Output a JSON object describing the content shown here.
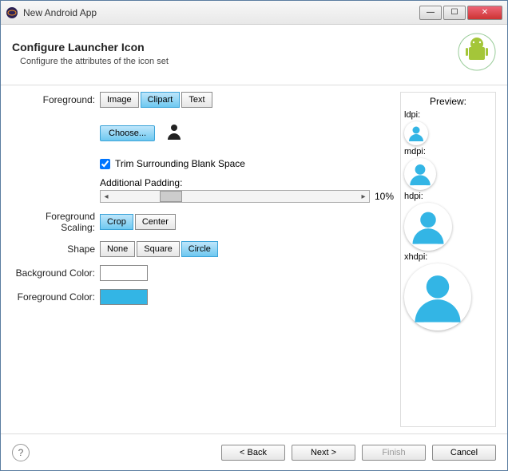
{
  "window": {
    "title": "New Android App"
  },
  "header": {
    "title": "Configure Launcher Icon",
    "subtitle": "Configure the attributes of the icon set"
  },
  "form": {
    "foreground_label": "Foreground:",
    "foreground_options": {
      "image": "Image",
      "clipart": "Clipart",
      "text": "Text"
    },
    "choose_label": "Choose...",
    "trim_label": "Trim Surrounding Blank Space",
    "trim_checked": true,
    "padding_label": "Additional Padding:",
    "padding_value": "10%",
    "scaling_label": "Foreground Scaling:",
    "scaling_options": {
      "crop": "Crop",
      "center": "Center"
    },
    "shape_label": "Shape",
    "shape_options": {
      "none": "None",
      "square": "Square",
      "circle": "Circle"
    },
    "bgcolor_label": "Background Color:",
    "bgcolor_value": "#ffffff",
    "fgcolor_label": "Foreground Color:",
    "fgcolor_value": "#33b5e5"
  },
  "preview": {
    "title": "Preview:",
    "ldpi": "ldpi:",
    "mdpi": "mdpi:",
    "hdpi": "hdpi:",
    "xhdpi": "xhdpi:"
  },
  "footer": {
    "back": "< Back",
    "next": "Next >",
    "finish": "Finish",
    "cancel": "Cancel"
  }
}
